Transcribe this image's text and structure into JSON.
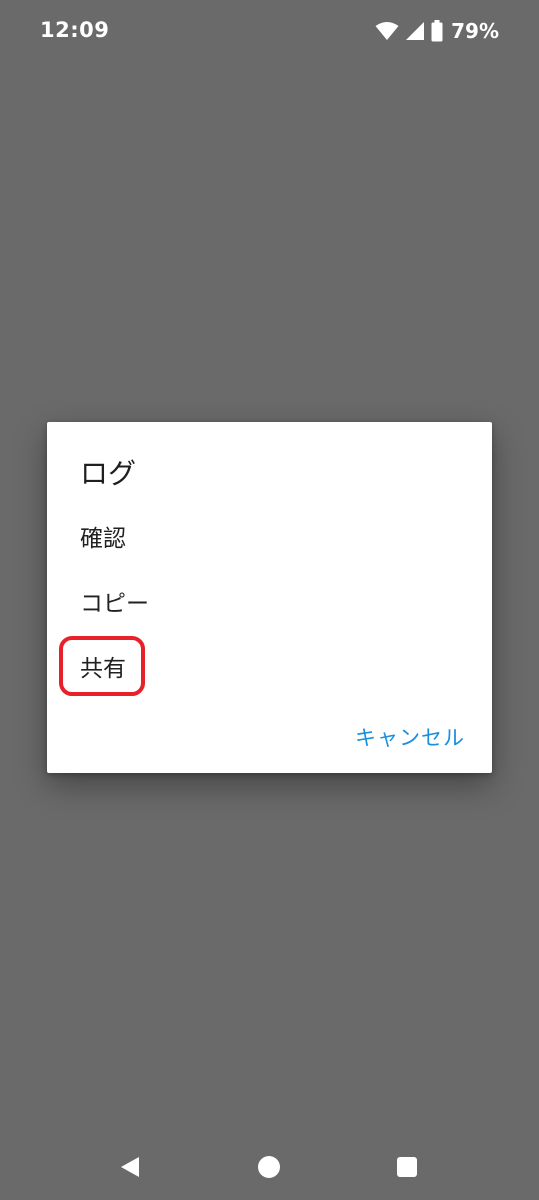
{
  "status_bar": {
    "time": "12:09",
    "battery_percent": "79%",
    "icons": [
      "wifi-icon",
      "cellular-signal-icon",
      "battery-icon"
    ]
  },
  "dialog": {
    "title": "ログ",
    "items": [
      {
        "label": "確認"
      },
      {
        "label": "コピー"
      },
      {
        "label": "共有"
      }
    ],
    "cancel_label": "キャンセル",
    "highlighted_item": "共有"
  },
  "colors": {
    "scrim": "#6a6a6a",
    "dialog_bg": "#ffffff",
    "accent": "#1a8fe0",
    "highlight": "#e8202a"
  },
  "nav_bar": {
    "icons": [
      "back-icon",
      "home-icon",
      "recents-icon"
    ]
  }
}
